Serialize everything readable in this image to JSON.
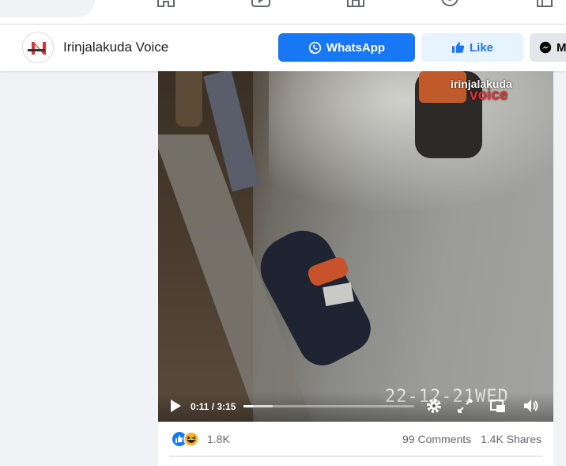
{
  "page": {
    "name": "Irinjalakuda Voice",
    "avatar_text": "N"
  },
  "actions": {
    "whatsapp_label": "WhatsApp",
    "like_label": "Like",
    "message_label": "M"
  },
  "video": {
    "watermark_top": "irinjalakuda",
    "watermark_bottom": "voice",
    "date_stamp": "22-12-21WED",
    "current_time": "0:11",
    "duration": "3:15",
    "time_display": "0:11 / 3:15",
    "progress_fraction": 0.056,
    "buffered_fraction": 0.17
  },
  "post": {
    "reaction_count": "1.8K",
    "comments": "99 Comments",
    "shares": "1.4K Shares"
  },
  "icons": {
    "nav": [
      "home-icon",
      "watch-icon",
      "marketplace-icon",
      "groups-icon",
      "gaming-icon"
    ],
    "reactions": [
      "like-reaction-icon",
      "haha-reaction-icon"
    ],
    "video_controls": [
      "play-icon",
      "settings-icon",
      "fullscreen-icon",
      "pip-icon",
      "volume-icon"
    ]
  },
  "colors": {
    "brand_blue": "#1877f2",
    "light_blue": "#e7f3ff",
    "page_bg": "#f0f2f5"
  }
}
